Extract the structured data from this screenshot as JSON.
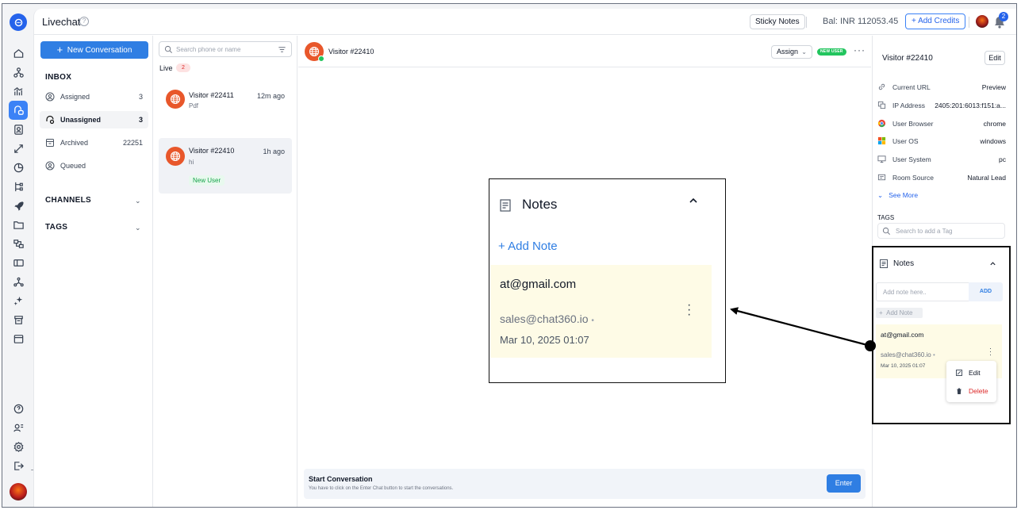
{
  "header": {
    "title": "Livechat",
    "help": "?",
    "sticky_notes": "Sticky Notes",
    "balance": "Bal: INR 112053.45",
    "add_credits": "Add Credits",
    "notifications_count": "2"
  },
  "inbox": {
    "new_conversation": "New Conversation",
    "inbox_title": "INBOX",
    "items": [
      {
        "label": "Assigned",
        "count": "3"
      },
      {
        "label": "Unassigned",
        "count": "3"
      },
      {
        "label": "Archived",
        "count": "22251"
      },
      {
        "label": "Queued",
        "count": ""
      }
    ],
    "channels": "CHANNELS",
    "tags": "TAGS"
  },
  "conversations": {
    "search_placeholder": "Search phone or name",
    "live_label": "Live",
    "live_count": "2",
    "list": [
      {
        "name": "Visitor #22411",
        "time": "12m ago",
        "message": "Pdf",
        "tag": ""
      },
      {
        "name": "Visitor #22410",
        "time": "1h ago",
        "message": "hi",
        "tag": "New User"
      }
    ]
  },
  "chat": {
    "visitor": "Visitor #22410",
    "assign": "Assign",
    "new_user_badge": "NEW USER",
    "more": "···",
    "start_title": "Start Conversation",
    "start_subtitle": "You have to click on the Enter Chat button to start the conversations.",
    "enter_button": "Enter"
  },
  "details": {
    "name": "Visitor #22410",
    "edit": "Edit",
    "rows": [
      {
        "key": "Current URL",
        "value": "Preview",
        "icon": "link-icon"
      },
      {
        "key": "IP Address",
        "value": "2405:201:6013:f151:a...",
        "icon": "copy-icon"
      },
      {
        "key": "User Browser",
        "value": "chrome",
        "icon": "chrome-icon"
      },
      {
        "key": "User OS",
        "value": "windows",
        "icon": "windows-icon"
      },
      {
        "key": "User System",
        "value": "pc",
        "icon": "monitor-icon"
      },
      {
        "key": "Room Source",
        "value": "Natural Lead",
        "icon": "source-icon"
      }
    ],
    "see_more": "See More",
    "tags_title": "TAGS",
    "tag_placeholder": "Search to add a Tag"
  },
  "notes": {
    "title": "Notes",
    "input_placeholder": "Add note here..",
    "add_button": "ADD",
    "add_note": "Add Note",
    "note": {
      "text": "at@gmail.com",
      "author": "sales@chat360.io",
      "date": "Mar 10, 2025 01:07"
    },
    "menu": {
      "edit": "Edit",
      "delete": "Delete"
    }
  },
  "zoom": {
    "title": "Notes",
    "add_note": "+ Add Note",
    "note_text": "at@gmail.com",
    "note_author": "sales@chat360.io",
    "note_date": "Mar 10, 2025 01:07"
  },
  "colors": {
    "accent": "#2f7ee3",
    "visitor_avatar": "#e8572b",
    "note_bg": "#fefbe6",
    "new_user": "#22c55e",
    "delete": "#dc2626"
  }
}
